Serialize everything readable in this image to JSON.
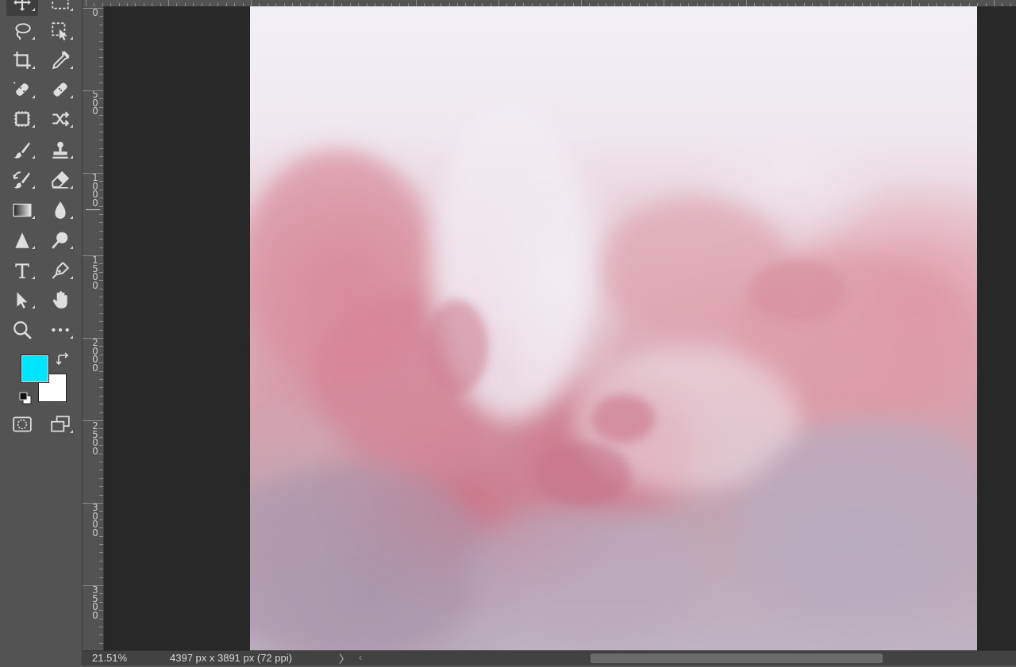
{
  "toolbar": {
    "tools": [
      {
        "name": "move-tool",
        "icon": "move-icon"
      },
      {
        "name": "marquee-tool",
        "icon": "rect-marquee-icon"
      },
      {
        "name": "lasso-tool",
        "icon": "lasso-icon"
      },
      {
        "name": "object-select-tool",
        "icon": "object-select-icon"
      },
      {
        "name": "crop-tool",
        "icon": "crop-icon"
      },
      {
        "name": "eyedropper-tool",
        "icon": "eyedropper-icon"
      },
      {
        "name": "spot-healing-tool",
        "icon": "spot-healing-icon"
      },
      {
        "name": "healing-brush-tool",
        "icon": "bandage-icon"
      },
      {
        "name": "patch-tool",
        "icon": "patch-icon"
      },
      {
        "name": "content-aware-move-tool",
        "icon": "shuffle-icon"
      },
      {
        "name": "brush-tool",
        "icon": "brush-icon"
      },
      {
        "name": "clone-stamp-tool",
        "icon": "stamp-icon"
      },
      {
        "name": "history-brush-tool",
        "icon": "history-brush-icon"
      },
      {
        "name": "eraser-tool",
        "icon": "eraser-icon"
      },
      {
        "name": "gradient-tool",
        "icon": "gradient-icon"
      },
      {
        "name": "blur-tool",
        "icon": "drop-icon"
      },
      {
        "name": "sharpen-tool",
        "icon": "triangle-icon"
      },
      {
        "name": "dodge-tool",
        "icon": "dodge-icon"
      },
      {
        "name": "type-tool",
        "icon": "type-icon"
      },
      {
        "name": "pen-tool",
        "icon": "pen-icon"
      },
      {
        "name": "path-select-tool",
        "icon": "arrow-icon"
      },
      {
        "name": "hand-tool",
        "icon": "hand-icon"
      },
      {
        "name": "zoom-tool",
        "icon": "magnifier-icon"
      },
      {
        "name": "more-tools",
        "icon": "ellipsis-icon"
      }
    ],
    "foreground_color": "#00e5ff",
    "background_color": "#ffffff"
  },
  "ruler": {
    "left_labels": [
      "0",
      "500",
      "1000",
      "1500",
      "2000",
      "2500",
      "3000",
      "3500"
    ]
  },
  "status_bar": {
    "zoom": "21.51%",
    "doc_info": "4397 px x 3891 px (72 ppi)",
    "more_arrow": "〉",
    "scroll_left": "‹"
  }
}
